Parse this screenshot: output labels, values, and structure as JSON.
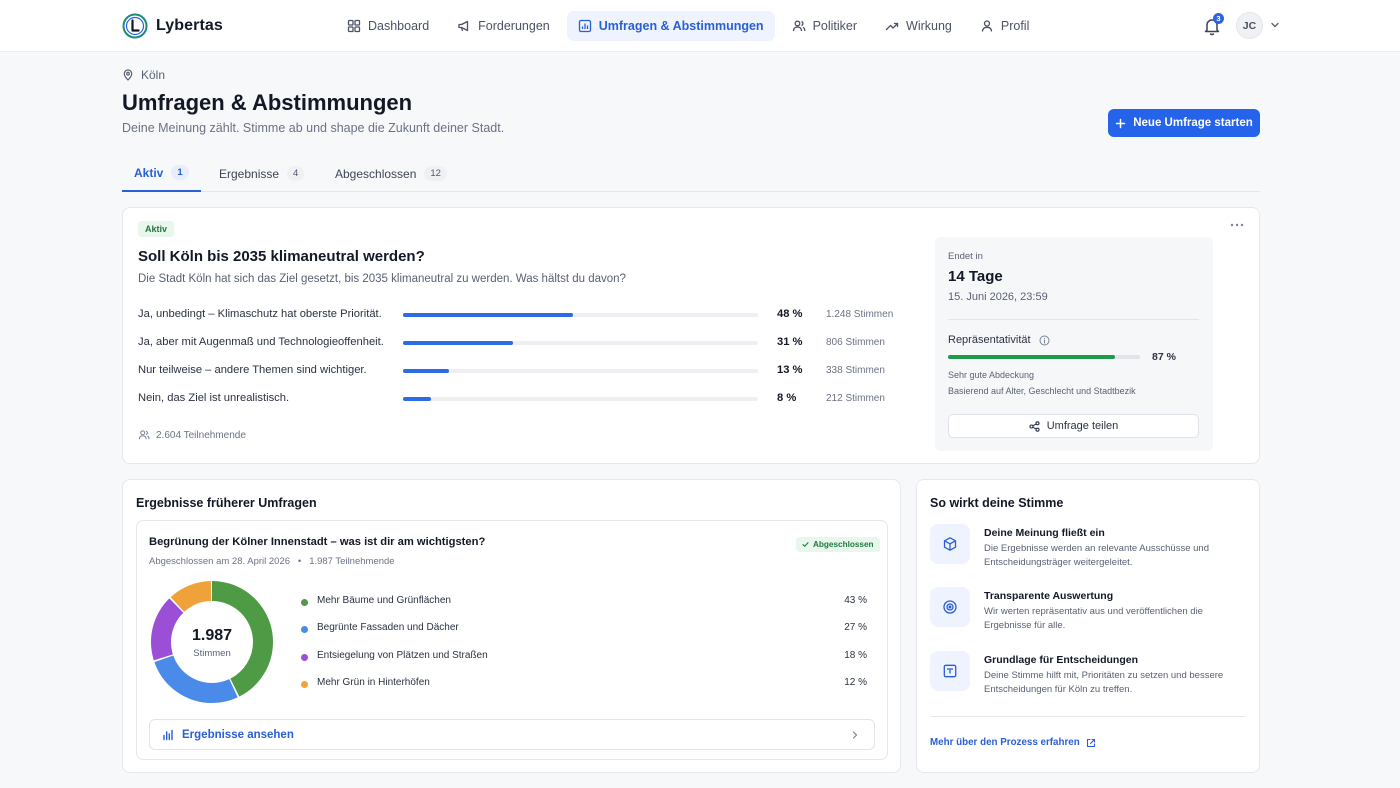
{
  "brand": {
    "name": "Lybertas"
  },
  "nav": [
    {
      "label": "Dashboard",
      "icon": "grid-icon",
      "active": false
    },
    {
      "label": "Forderungen",
      "icon": "megaphone-icon",
      "active": false
    },
    {
      "label": "Umfragen & Abstimmungen",
      "icon": "poll-icon",
      "active": true
    },
    {
      "label": "Politiker",
      "icon": "users-icon",
      "active": false
    },
    {
      "label": "Wirkung",
      "icon": "trend-icon",
      "active": false
    },
    {
      "label": "Profil",
      "icon": "user-icon",
      "active": false
    }
  ],
  "notifications": {
    "count": "3"
  },
  "user": {
    "initials": "JC"
  },
  "header": {
    "location": "Köln",
    "title": "Umfragen & Abstimmungen",
    "subtitle": "Deine Meinung zählt. Stimme ab und shape die Zukunft deiner Stadt.",
    "new_poll_button": "Neue Umfrage starten"
  },
  "tabs": [
    {
      "label": "Aktiv",
      "count": "1",
      "active": true
    },
    {
      "label": "Ergebnisse",
      "count": "4",
      "active": false
    },
    {
      "label": "Abgeschlossen",
      "count": "12",
      "active": false
    }
  ],
  "active_poll": {
    "status": "Aktiv",
    "question": "Soll Köln bis 2035 klimaneutral werden?",
    "description": "Die Stadt Köln hat sich das Ziel gesetzt, bis 2035 klimaneutral zu werden. Was hältst du davon?",
    "options": [
      {
        "label": "Ja, unbedingt – Klimaschutz hat oberste Priorität.",
        "percent": 48,
        "percent_text": "48 %",
        "votes": "1.248 Stimmen"
      },
      {
        "label": "Ja, aber mit Augenmaß und Technologieoffenheit.",
        "percent": 31,
        "percent_text": "31 %",
        "votes": "806 Stimmen"
      },
      {
        "label": "Nur teilweise – andere Themen sind wichtiger.",
        "percent": 13,
        "percent_text": "13 %",
        "votes": "338 Stimmen"
      },
      {
        "label": "Nein, das Ziel ist unrealistisch.",
        "percent": 8,
        "percent_text": "8 %",
        "votes": "212 Stimmen"
      }
    ],
    "participants": "2.604 Teilnehmende",
    "ends_label": "Endet in",
    "ends_value": "14 Tage",
    "ends_date": "15. Juni 2026, 23:59",
    "representativity_label": "Repräsentativität",
    "representativity_value": 87,
    "representativity_text": "87 %",
    "representativity_quality": "Sehr gute Abdeckung",
    "representativity_basis": "Basierend auf Alter, Geschlecht und Stadtbezik",
    "share_button": "Umfrage teilen"
  },
  "past_results": {
    "title": "Ergebnisse früherer Umfragen",
    "poll": {
      "question": "Begrünung der Kölner Innenstadt – was ist dir am wichtigsten?",
      "status": "Abgeschlossen",
      "closed_date": "Abgeschlossen am 28. April 2026",
      "participants": "1.987 Teilnehmende",
      "total_votes": "1.987",
      "total_label": "Stimmen",
      "view_button": "Ergebnisse ansehen"
    }
  },
  "chart_data": {
    "type": "pie",
    "categories": [
      "Mehr Bäume und Grünflächen",
      "Begrünte Fassaden und Dächer",
      "Entsiegelung von Plätzen und Straßen",
      "Mehr Grün in Hinterhöfen"
    ],
    "values": [
      43,
      27,
      18,
      12
    ],
    "value_labels": [
      "43 %",
      "27 %",
      "18 %",
      "12 %"
    ],
    "colors": [
      "#4f9a45",
      "#4a8ae8",
      "#9b4fd6",
      "#f0a23a"
    ]
  },
  "impact": {
    "title": "So wirkt deine Stimme",
    "items": [
      {
        "title": "Deine Meinung fließt ein",
        "text": "Die Ergebnisse werden an relevante Ausschüsse und Entscheidungsträger weitergeleitet.",
        "icon": "cube-icon"
      },
      {
        "title": "Transparente Auswertung",
        "text": "Wir werten repräsentativ aus und veröffentlichen die Ergebnisse für alle.",
        "icon": "target-icon"
      },
      {
        "title": "Grundlage für Entscheidungen",
        "text": "Deine Stimme hilft mit, Prioritäten zu setzen und bessere Entscheidungen für Köln zu treffen.",
        "icon": "board-icon"
      }
    ],
    "link": "Mehr über den Prozess erfahren"
  }
}
